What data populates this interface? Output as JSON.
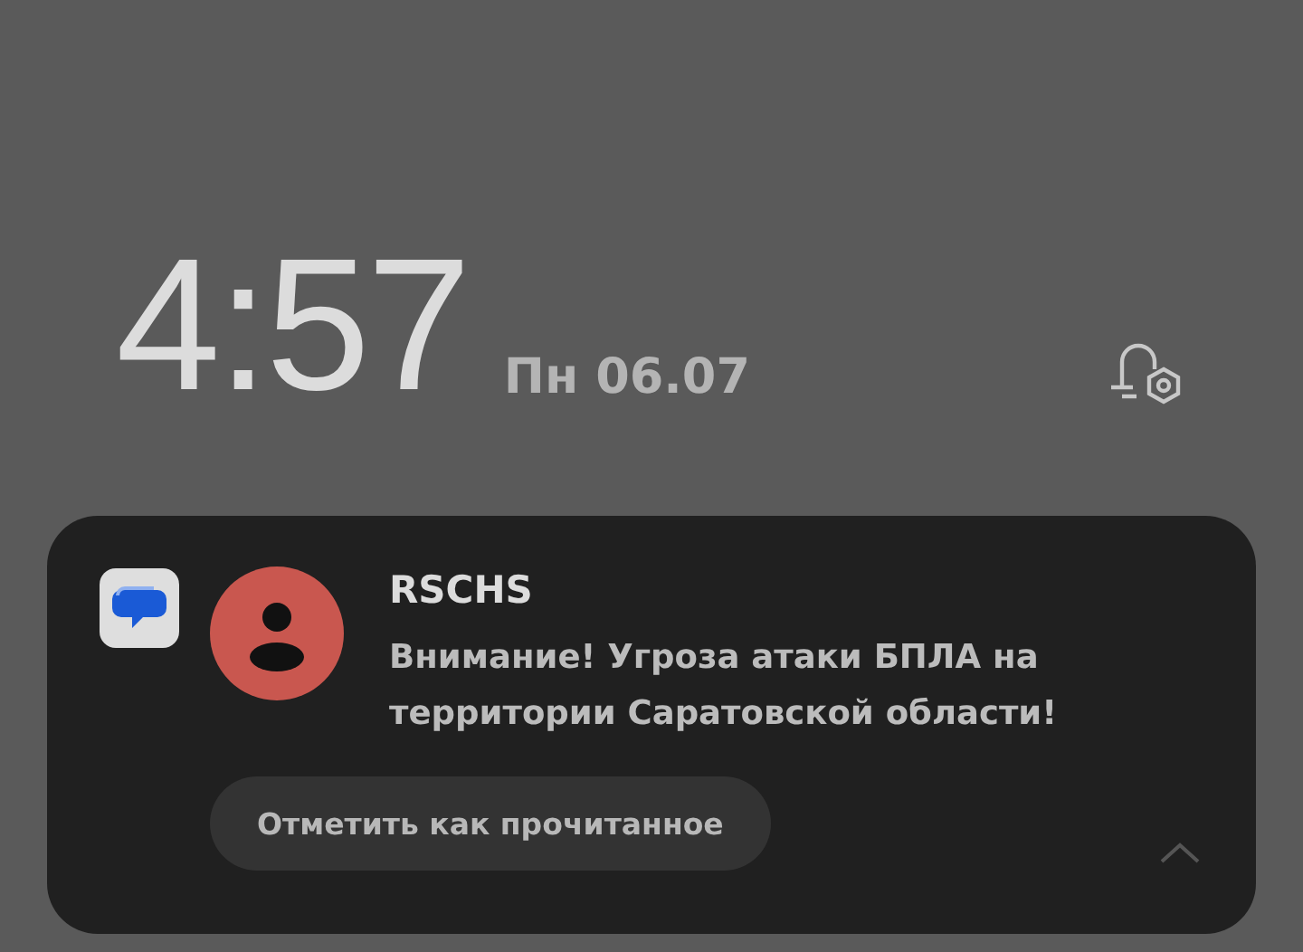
{
  "clock": {
    "time": "4:57",
    "date": "Пн 06.07"
  },
  "notification": {
    "sender": "RSCHS",
    "message": "Внимание! Угроза атаки БПЛА на территории Саратовской области!",
    "action": "Отметить как прочитанное",
    "expanded": true
  }
}
